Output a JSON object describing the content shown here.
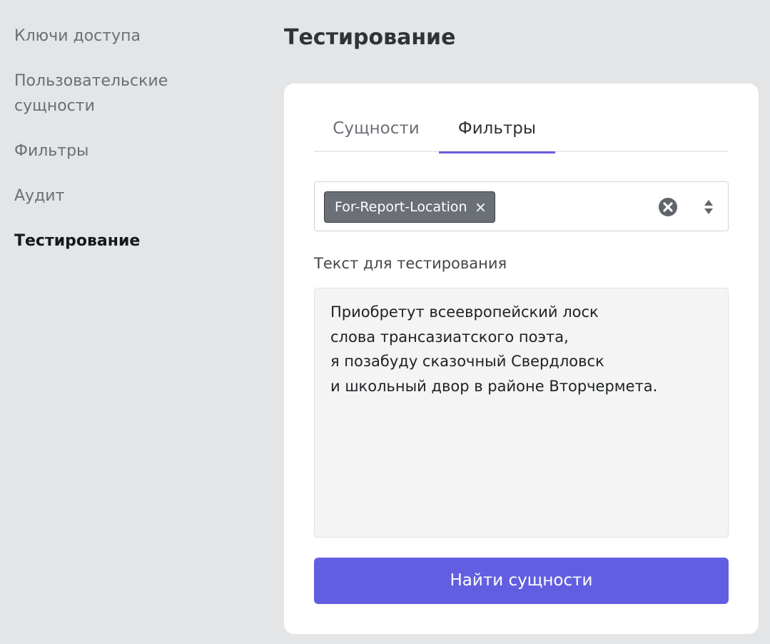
{
  "sidebar": {
    "items": [
      {
        "label": "Ключи доступа"
      },
      {
        "label": "Пользовательские\nсущности"
      },
      {
        "label": "Фильтры"
      },
      {
        "label": "Аудит"
      },
      {
        "label": "Тестирование"
      }
    ]
  },
  "page": {
    "title": "Тестирование"
  },
  "tabs": [
    {
      "label": "Сущности"
    },
    {
      "label": "Фильтры"
    }
  ],
  "filter_select": {
    "selected_chip": "For-Report-Location",
    "chip_remove_glyph": "×",
    "clear_icon": "clear-circle-icon",
    "sort_icon": "sort-updown-icon"
  },
  "test_text": {
    "label": "Текст для тестирования",
    "value": "Приобретут всеевропейский лоск\nслова трансазиатского поэта,\nя позабуду сказочный Свердловск\nи школьный двор в районе Вторчермета."
  },
  "submit_label": "Найти сущности",
  "colors": {
    "accent": "#625ee1",
    "tab_underline": "#6a5fdd",
    "chip_bg": "#6b7077",
    "page_bg": "#e4e5e7"
  }
}
